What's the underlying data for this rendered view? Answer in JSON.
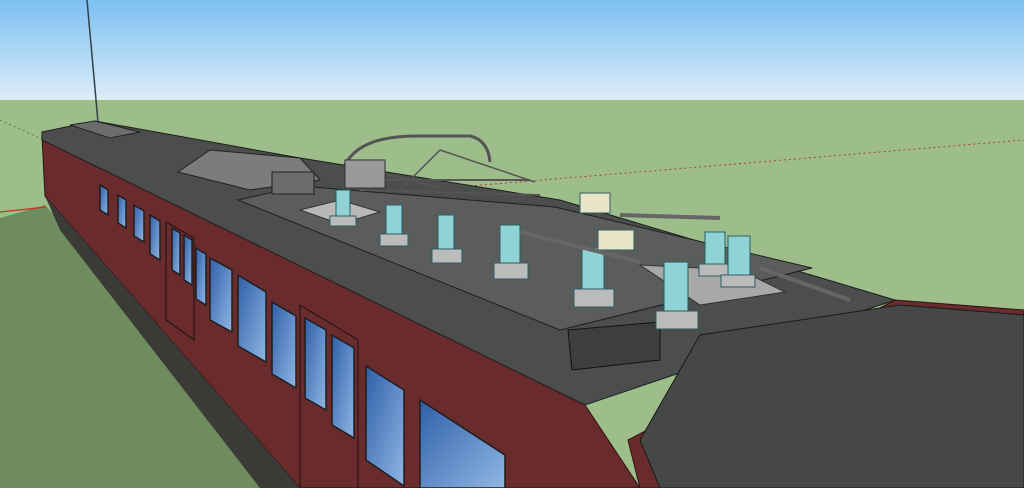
{
  "scene": {
    "subject": "train-car-3d-model",
    "colors": {
      "sky_top": "#7cc0f2",
      "sky_horizon": "#dcedf8",
      "ground": "#9dbd8a",
      "ground_shadow": "#6f8c5e",
      "roof": "#4b4e4c",
      "roof_platform": "#5a5d5b",
      "body": "#6a2b2c",
      "window": "#4f7fc0",
      "insulator": "#8fd3d6",
      "axis_red": "#d03020"
    }
  }
}
